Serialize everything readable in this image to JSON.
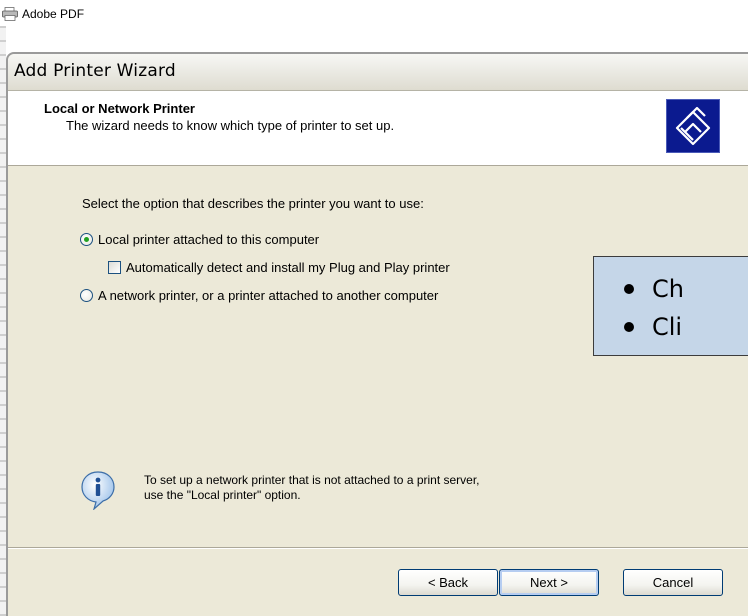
{
  "background": {
    "item_label": "Adobe PDF",
    "item_icon": "printer-icon"
  },
  "window": {
    "title": "Add Printer Wizard"
  },
  "header": {
    "title": "Local or Network Printer",
    "subtitle": "The wizard needs to know which type of printer to set up.",
    "icon": "printer-wizard-icon"
  },
  "body": {
    "prompt": "Select the option that describes the printer you want to use:",
    "options": [
      {
        "label": "Local printer attached to this computer",
        "selected": true
      },
      {
        "label": "A network printer, or a printer attached to another computer",
        "selected": false
      }
    ],
    "checkbox": {
      "label": "Automatically detect and install my Plug and Play printer",
      "checked": false
    },
    "info": {
      "icon": "info-icon",
      "line1": "To set up a network printer that is not attached to a print server,",
      "line2": "use the \"Local printer\" option."
    }
  },
  "buttons": {
    "back": "< Back",
    "next": "Next >",
    "cancel": "Cancel"
  },
  "callout": {
    "items": [
      "Ch",
      "Cli"
    ]
  },
  "colors": {
    "dialog_bg": "#ece9d8",
    "callout_bg": "#c5d6e8",
    "wizard_icon_bg": "#0b1a8f"
  }
}
